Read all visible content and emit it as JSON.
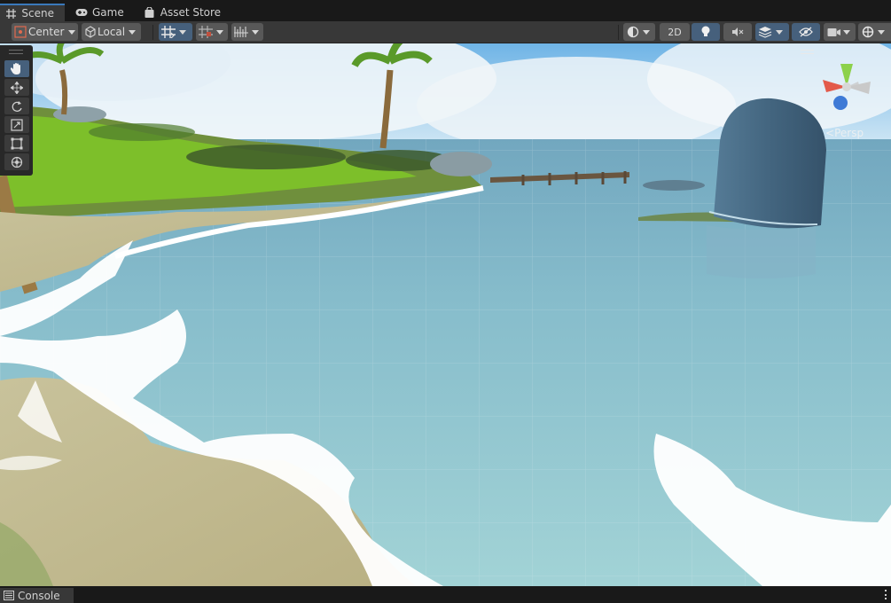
{
  "tabs": [
    {
      "label": "Scene",
      "icon": "grid-icon",
      "active": true
    },
    {
      "label": "Game",
      "icon": "gamepad-icon",
      "active": false
    },
    {
      "label": "Asset Store",
      "icon": "store-bag-icon",
      "active": false
    }
  ],
  "toolbar": {
    "pivot_label": "Center",
    "rotation_label": "Local",
    "mode_2d_label": "2D"
  },
  "tools": [
    "hand-tool",
    "move-tool",
    "rotate-tool",
    "scale-tool",
    "rect-tool",
    "transform-tool"
  ],
  "scene": {
    "persp_label": "Persp"
  },
  "console": {
    "tab_label": "Console"
  },
  "colors": {
    "accent": "#46607c",
    "active_tab_line": "#3a79bb"
  }
}
